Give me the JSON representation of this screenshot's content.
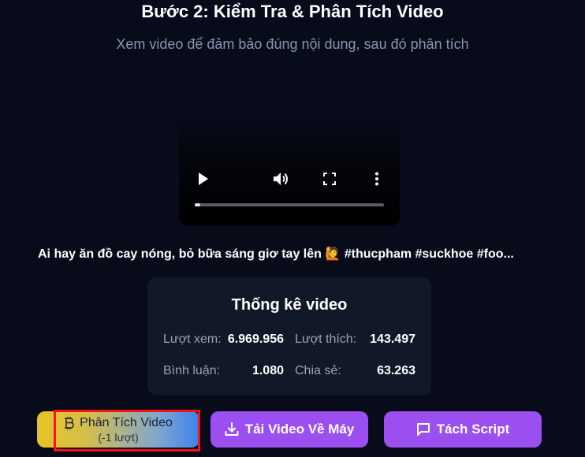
{
  "header": {
    "title": "Bước 2: Kiểm Tra & Phân Tích Video",
    "subtitle": "Xem video để đảm bảo đúng nội dung, sau đó phân tích"
  },
  "video": {
    "controls": [
      "play-icon",
      "volume-icon",
      "fullscreen-icon",
      "more-vert-icon"
    ],
    "progress": 0.03,
    "caption": "Ai hay ăn đồ cay nóng, bỏ bữa sáng giơ tay lên 🙋 #thucpham #suckhoe #foo..."
  },
  "stats": {
    "title": "Thống kê video",
    "views_label": "Lượt xem:",
    "views_value": "6.969.956",
    "likes_label": "Lượt thích:",
    "likes_value": "143.497",
    "comments_label": "Bình luận:",
    "comments_value": "1.080",
    "shares_label": "Chia sẻ:",
    "shares_value": "63.263"
  },
  "actions": {
    "analyze_label": "Phân Tích Video",
    "analyze_cost": "(-1 lượt)",
    "analyze_icon": "bitcoin-icon",
    "download_label": "Tải Video Về Máy",
    "download_icon": "download-icon",
    "script_label": "Tách Script",
    "script_icon": "message-square-icon"
  },
  "colors": {
    "background": "#070b1a",
    "card": "#111827",
    "button_purple": "#9b4ff0",
    "highlight": "#ff1010"
  }
}
